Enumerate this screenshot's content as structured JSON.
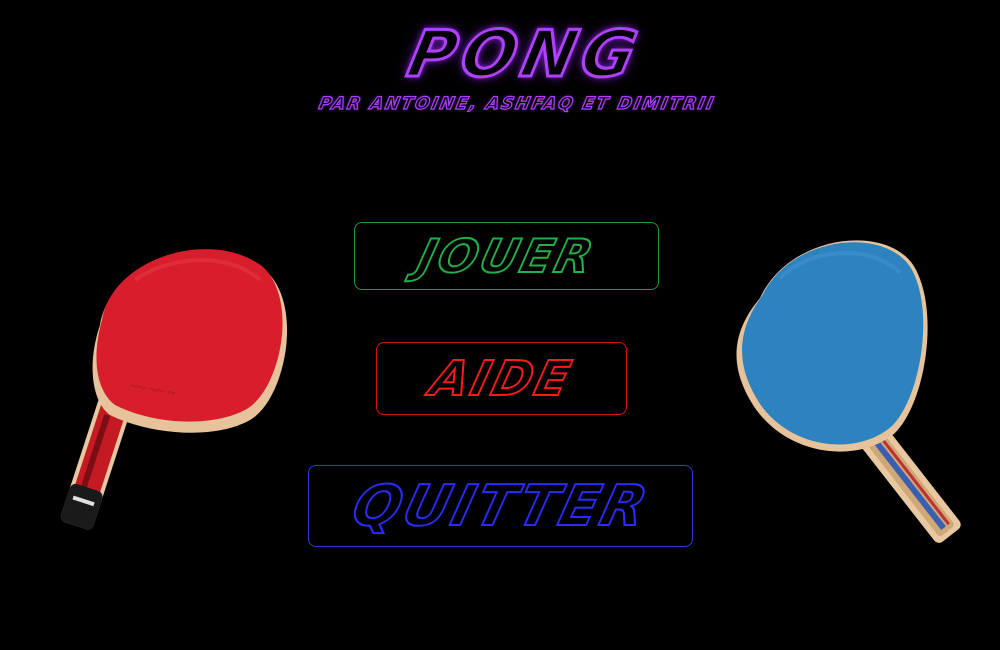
{
  "game": {
    "title": "PONG",
    "subtitle": "PAR ANTOINE, ASHFAQ ET DIMITRII"
  },
  "menu": {
    "play_label": "JOUER",
    "help_label": "AIDE",
    "quit_label": "QUITTER"
  },
  "colors": {
    "background": "#000000",
    "title": "#b040ff",
    "play": "#22b048",
    "help": "#ff1a1a",
    "quit": "#2a2cff",
    "paddle_left_rubber": "#d81e2c",
    "paddle_right_rubber": "#2d82c0"
  },
  "decorations": {
    "left_paddle": "red-ping-pong-paddle-icon",
    "right_paddle": "blue-ping-pong-paddle-icon"
  }
}
